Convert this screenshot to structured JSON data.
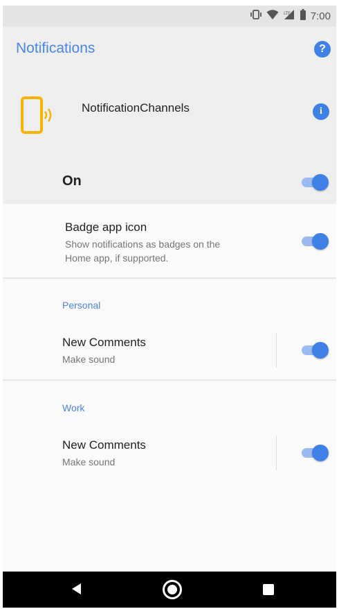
{
  "status_bar": {
    "time": "7:00",
    "icons": [
      "vibrate-icon",
      "wifi-icon",
      "lte-signal-icon",
      "battery-icon"
    ]
  },
  "header": {
    "title": "Notifications",
    "help_icon": "help-icon"
  },
  "app": {
    "name": "NotificationChannels",
    "icon": "phone-ringing-icon",
    "info_icon": "info-icon"
  },
  "master_toggle": {
    "label": "On",
    "checked": true
  },
  "badge": {
    "title": "Badge app icon",
    "subtitle_line1": "Show notifications as badges on the",
    "subtitle_line2": "Home app, if supported.",
    "checked": true
  },
  "channel_groups": [
    {
      "name": "Personal",
      "channels": [
        {
          "title": "New Comments",
          "subtitle": "Make sound",
          "checked": true
        }
      ]
    },
    {
      "name": "Work",
      "channels": [
        {
          "title": "New Comments",
          "subtitle": "Make sound",
          "checked": true
        }
      ]
    }
  ],
  "nav_bar": {
    "buttons": [
      "back-icon",
      "home-icon",
      "recents-icon"
    ]
  },
  "colors": {
    "accent": "#3f80e6",
    "title_blue": "#4a86e8",
    "header_bg": "#eeeeee",
    "app_icon_yellow": "#f4b400"
  }
}
